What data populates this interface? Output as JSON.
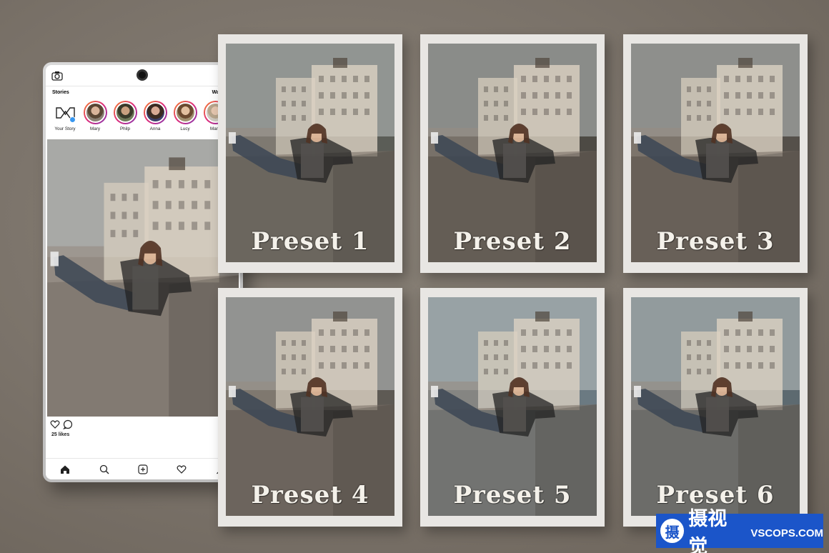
{
  "phone": {
    "stories_title": "Stories",
    "watch_all": "Watch All",
    "stories": [
      {
        "name": "Your Story"
      },
      {
        "name": "Mary"
      },
      {
        "name": "Philp"
      },
      {
        "name": "Anna"
      },
      {
        "name": "Lucy"
      },
      {
        "name": "Mark"
      }
    ],
    "likes": "25 likes",
    "icons": {
      "top_left": "camera-icon",
      "top_right": "add-user-icon",
      "actions": [
        "heart-icon",
        "comment-icon",
        "bookmark-icon"
      ],
      "nav": [
        "home-icon",
        "search-icon",
        "add-post-icon",
        "heart-icon",
        "profile-icon"
      ]
    }
  },
  "presets": [
    {
      "label": "Preset 1",
      "tone": "#5b5d57"
    },
    {
      "label": "Preset 2",
      "tone": "#4d4a44"
    },
    {
      "label": "Preset 3",
      "tone": "#55504a"
    },
    {
      "label": "Preset 4",
      "tone": "#5e5a54"
    },
    {
      "label": "Preset 5",
      "tone": "#6b7a82"
    },
    {
      "label": "Preset 6",
      "tone": "#5d6a70"
    }
  ],
  "watermark": {
    "glyph": "摄",
    "cn": "摄视觉",
    "en": "VSCOPS.COM",
    "color": "#1b55c9"
  },
  "colors": {
    "background": "#7a7269",
    "card": "#e8e6e3",
    "story_ring": "#dd2a7b"
  }
}
